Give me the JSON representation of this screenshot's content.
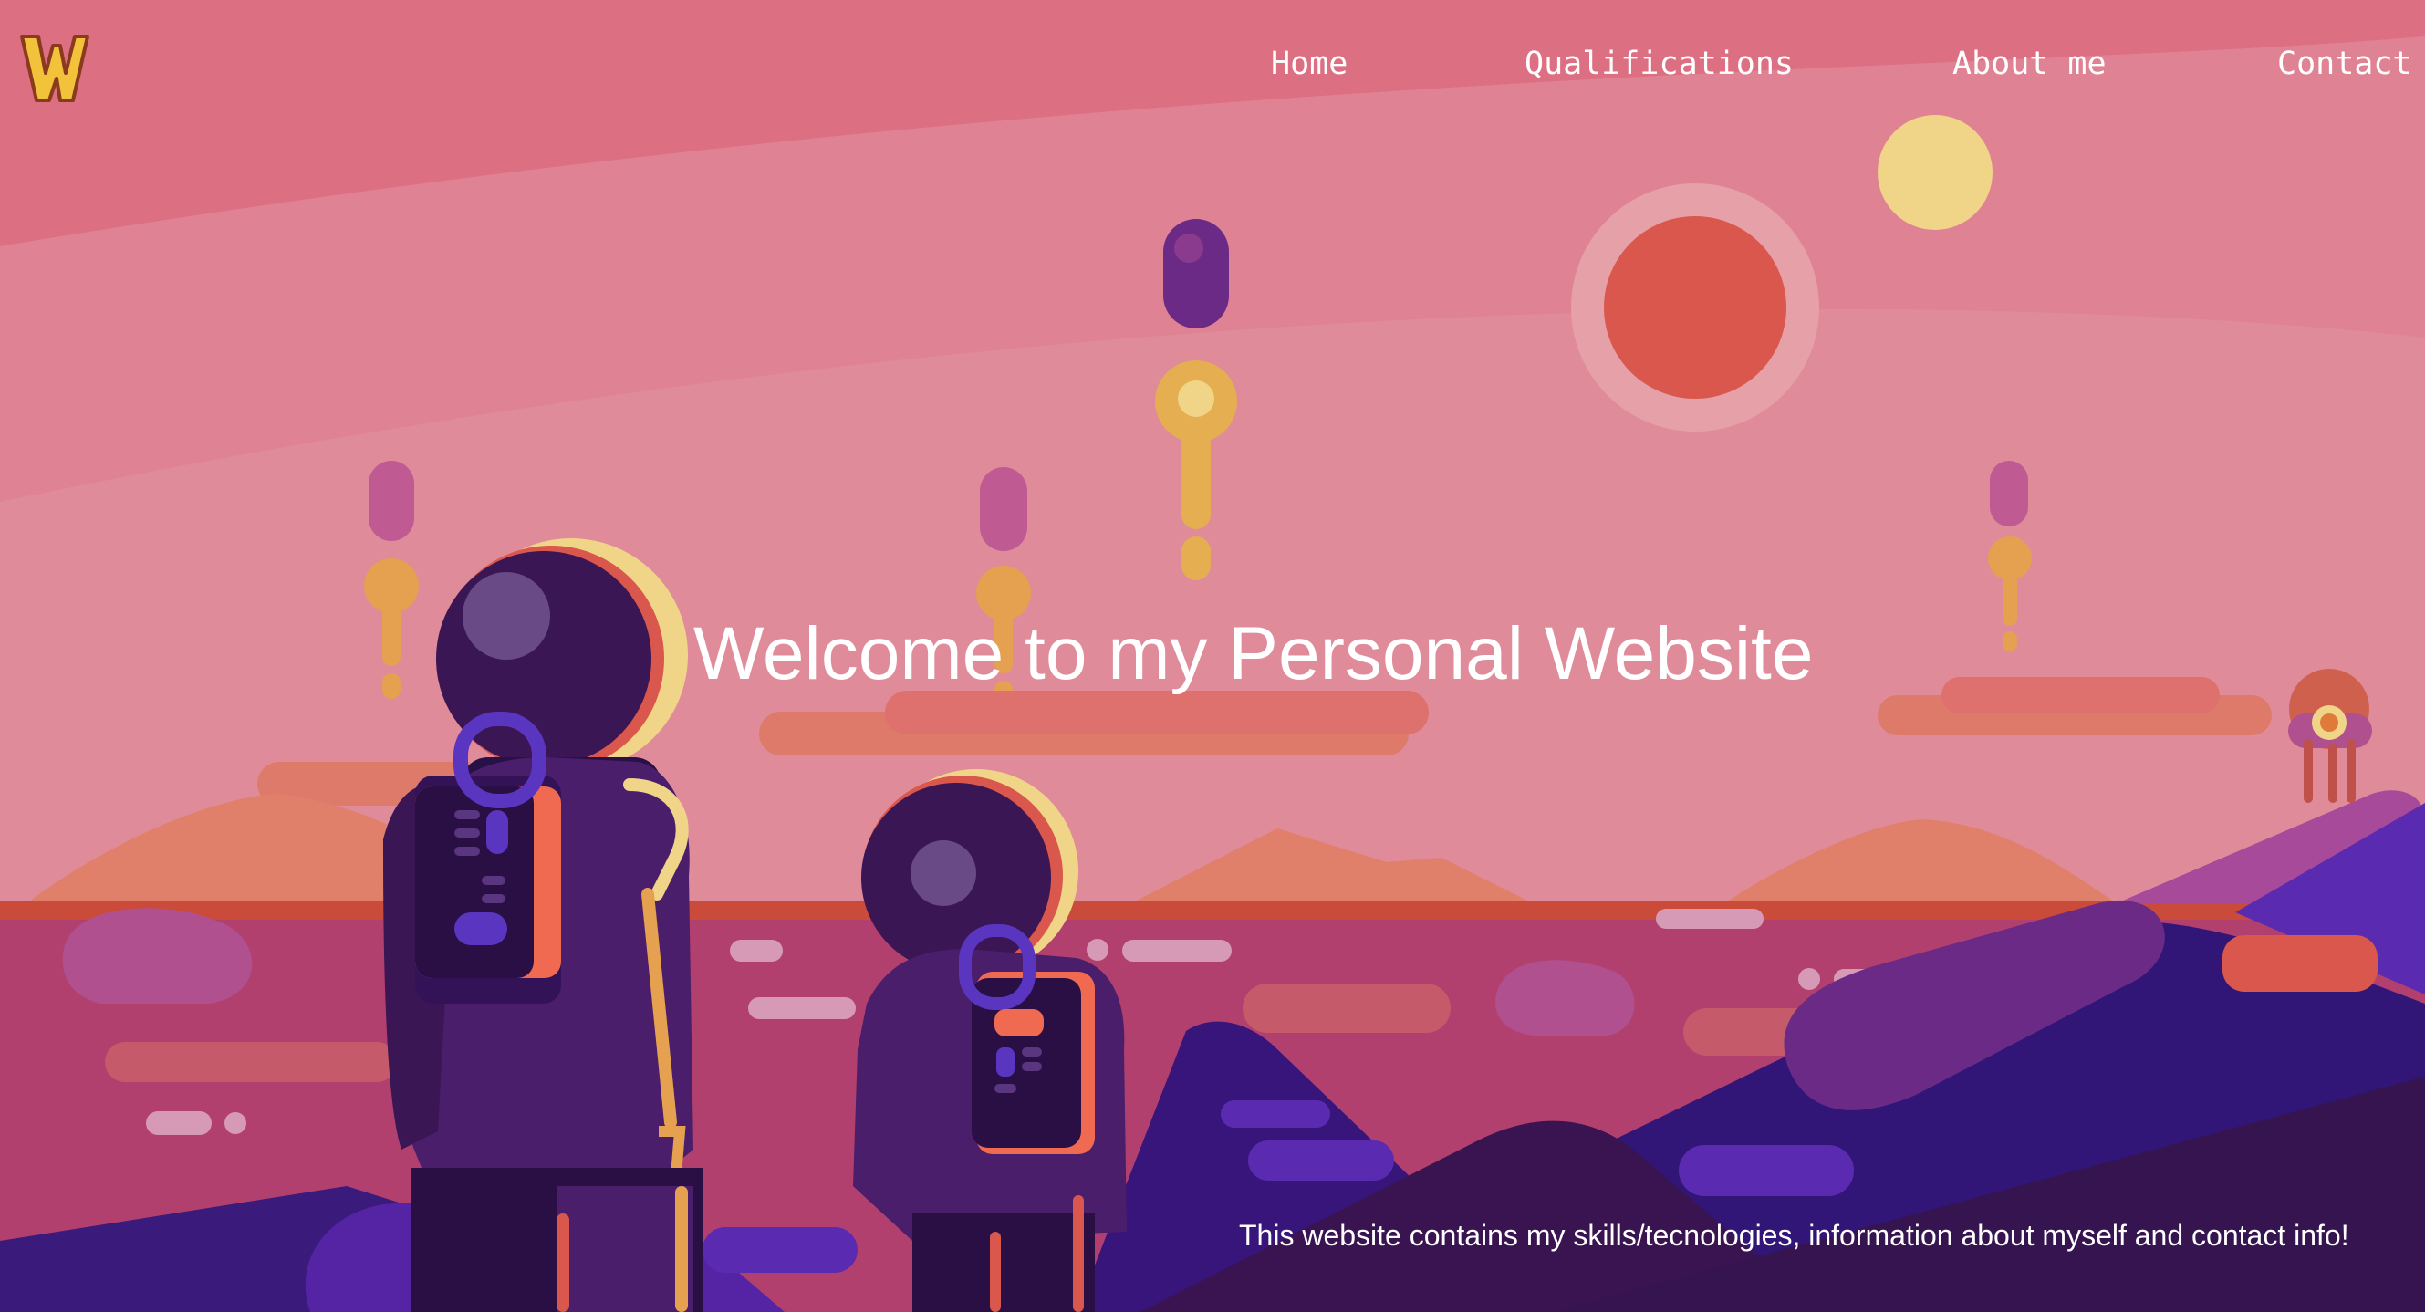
{
  "header": {
    "logo_icon": "w-logo-icon",
    "nav": [
      {
        "label": "Home"
      },
      {
        "label": "Qualifications"
      },
      {
        "label": "About me"
      },
      {
        "label": "Contact"
      }
    ]
  },
  "hero": {
    "title": "Welcome to my Personal Website",
    "subtitle": "This website contains my skills/tecnologies, information about myself and contact info!"
  },
  "colors": {
    "sky": "#e08b9a",
    "sky_top": "#dd6f83",
    "sun": "#d9574c",
    "moon": "#f0d488",
    "astronaut": "#3a1654",
    "mountains": "#351a78",
    "ground": "#b2406f",
    "text": "#ffffff"
  }
}
